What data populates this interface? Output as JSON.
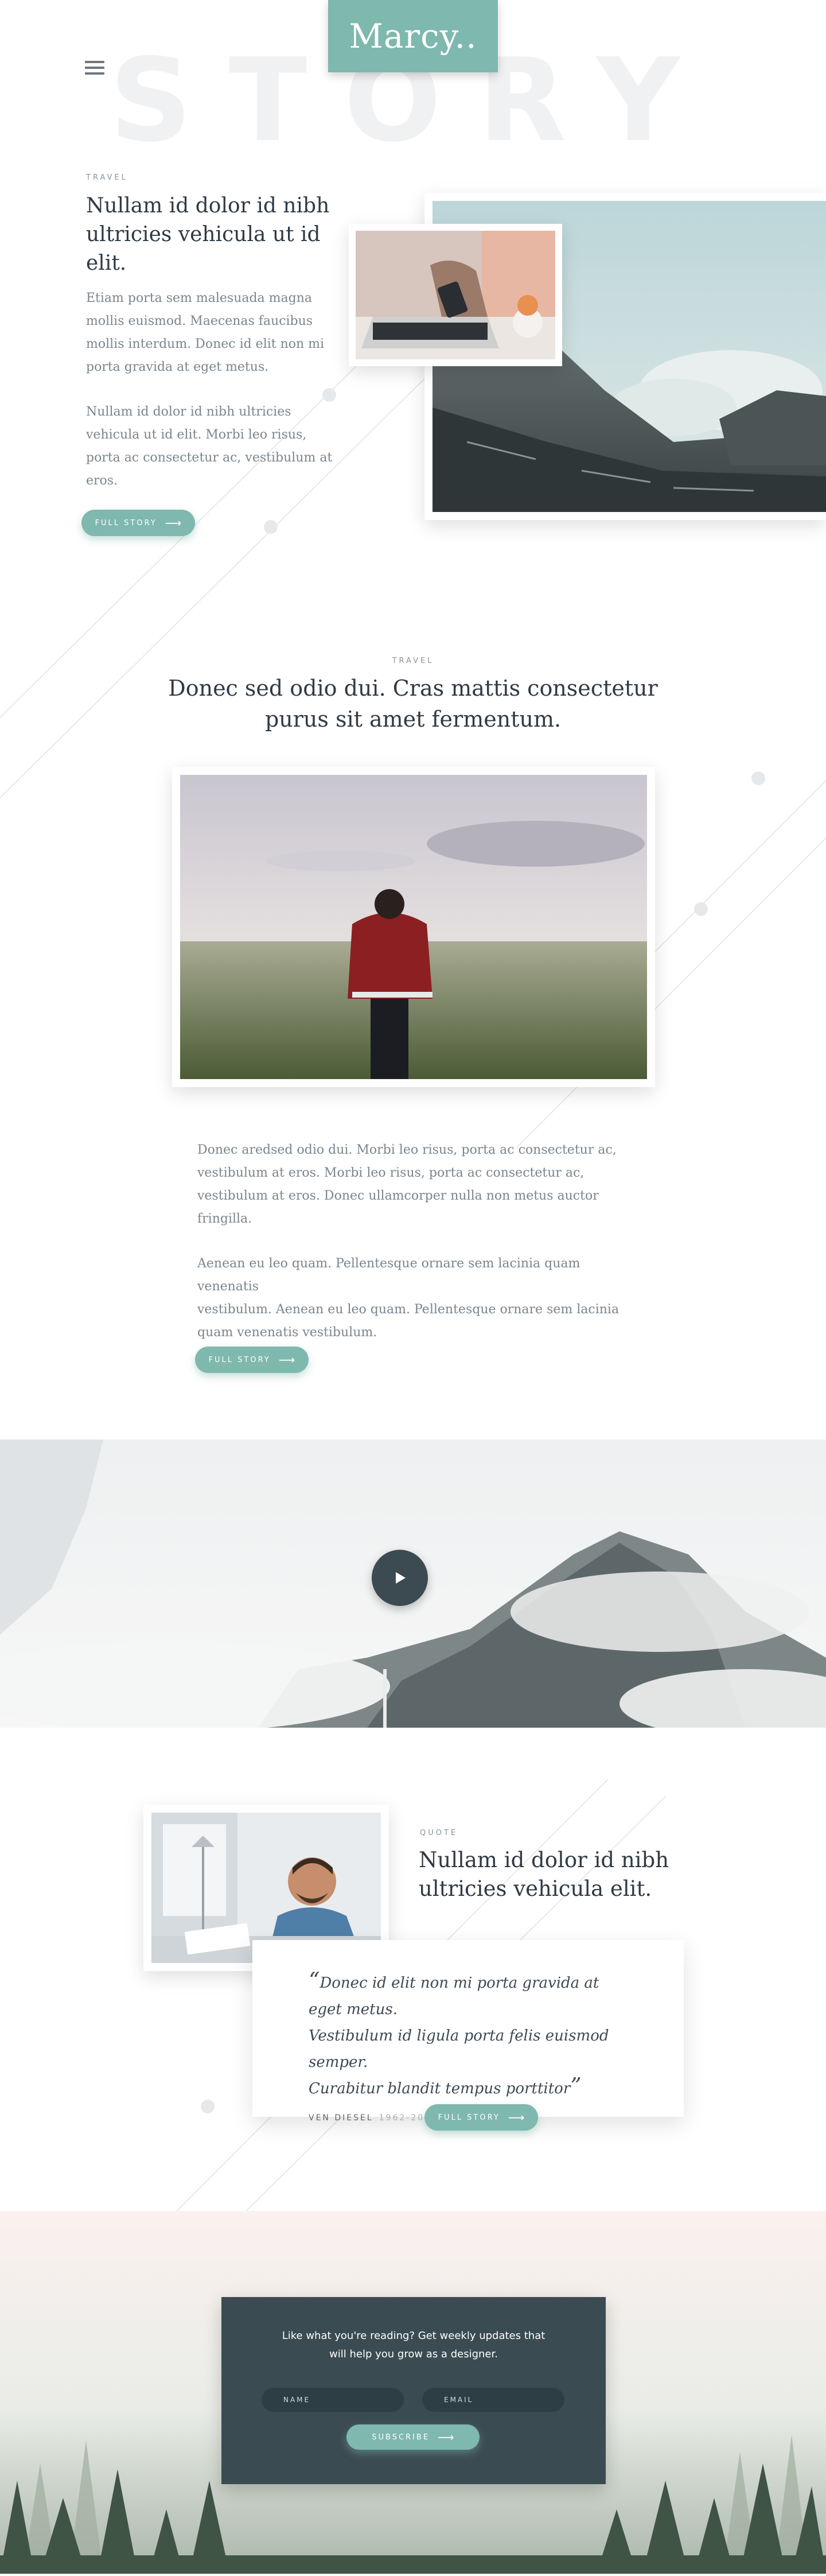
{
  "header": {
    "logo": "Marcy..",
    "watermark": "STORY",
    "menu_icon": "hamburger-menu-icon"
  },
  "story1": {
    "category": "TRAVEL",
    "title_line1": "Nullam id dolor id nibh",
    "title_line2": "ultricies vehicula ut id elit.",
    "para1": [
      "Etiam porta sem malesuada magna",
      "mollis euismod. Maecenas faucibus",
      "mollis interdum. Donec id elit non mi",
      "porta gravida at eget metus."
    ],
    "para2": [
      "Nullam id dolor id nibh ultricies",
      "vehicula ut id elit. Morbi leo risus,",
      "porta ac consectetur ac, vestibulum at",
      "eros."
    ],
    "button": "FULL STORY"
  },
  "story2": {
    "category": "TRAVEL",
    "title_line1": "Donec sed odio dui. Cras mattis consectetur",
    "title_line2": "purus sit amet fermentum.",
    "para1": [
      "Donec aredsed odio dui. Morbi leo risus, porta ac consectetur ac,",
      "vestibulum at eros. Morbi leo risus, porta ac consectetur ac,",
      "vestibulum at eros. Donec ullamcorper nulla non metus auctor",
      "fringilla."
    ],
    "para2": [
      "Aenean eu leo quam. Pellentesque ornare sem lacinia quam venenatis",
      "vestibulum. Aenean eu leo quam. Pellentesque ornare sem lacinia",
      "quam venenatis vestibulum."
    ],
    "button": "FULL STORY"
  },
  "video": {
    "play_icon": "play-icon"
  },
  "quote": {
    "category": "QUOTE",
    "title_line1": "Nullam id dolor id nibh",
    "title_line2": "ultricies vehicula elit.",
    "open_mark": "“",
    "close_mark": "”",
    "line1": "Donec id elit non mi porta gravida at eget metus.",
    "line2": "Vestibulum id ligula porta felis euismod semper.",
    "line3": "Curabitur blandit tempus porttitor",
    "author": "VEN DIESEL",
    "years": "1962-2006",
    "button": "FULL STORY"
  },
  "newsletter": {
    "line1": "Like what you're reading? Get weekly updates that",
    "line2": "will help you grow as a designer.",
    "name_placeholder": "NAME",
    "email_placeholder": "EMAIL",
    "button": "SUBSCRIBE"
  },
  "colors": {
    "accent": "#7fb8ae",
    "dark": "#3b4b52",
    "text": "#2f3a44",
    "muted": "#7a858d"
  }
}
